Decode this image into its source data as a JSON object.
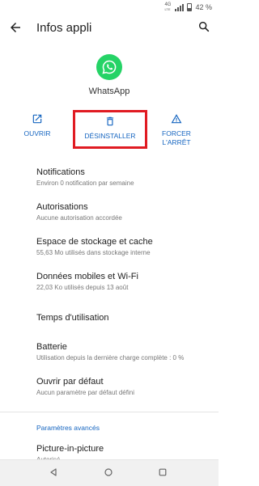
{
  "status": {
    "network": "4G",
    "network_sub": "LTE",
    "battery": "42 %"
  },
  "appbar": {
    "title": "Infos appli",
    "back_icon": "arrow-back-icon",
    "search_icon": "search-icon"
  },
  "app": {
    "name": "WhatsApp",
    "icon": "whatsapp-logo-icon",
    "icon_color": "#25D366"
  },
  "actions": [
    {
      "label": "OUVRIR",
      "icon": "open-external-icon"
    },
    {
      "label": "DÉSINSTALLER",
      "icon": "trash-icon"
    },
    {
      "label_line1": "FORCER",
      "label_line2": "L'ARRÊT",
      "icon": "warning-icon"
    }
  ],
  "highlight_color": "#e01b22",
  "accent_color": "#1565c0",
  "items": [
    {
      "title": "Notifications",
      "subtitle": "Environ 0 notification par semaine"
    },
    {
      "title": "Autorisations",
      "subtitle": "Aucune autorisation accordée"
    },
    {
      "title": "Espace de stockage et cache",
      "subtitle": "55,63 Mo utilisés dans stockage interne"
    },
    {
      "title": "Données mobiles et Wi-Fi",
      "subtitle": "22,03 Ko utilisés depuis 13 août"
    },
    {
      "title": "Temps d'utilisation",
      "subtitle": ""
    },
    {
      "title": "Batterie",
      "subtitle": "Utilisation depuis la dernière charge complète : 0 %"
    },
    {
      "title": "Ouvrir par défaut",
      "subtitle": "Aucun paramètre par défaut défini"
    }
  ],
  "advanced": {
    "section_label": "Paramètres avancés",
    "pip_title": "Picture-in-picture",
    "pip_subtitle": "Autorisé"
  },
  "navbar": {
    "back": "nav-back-icon",
    "home": "nav-home-icon",
    "recents": "nav-recents-icon"
  }
}
